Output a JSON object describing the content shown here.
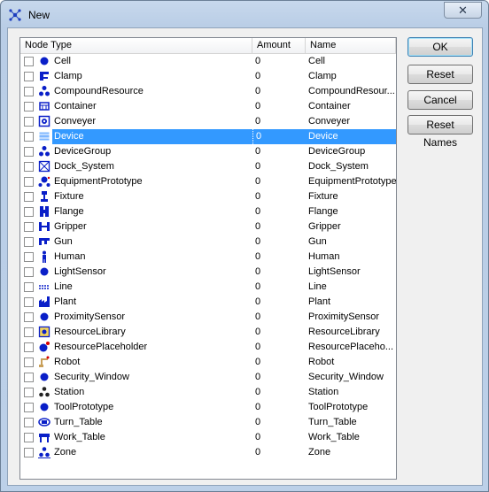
{
  "window": {
    "title": "New",
    "close_glyph": "✕"
  },
  "colors": {
    "selection": "#3399ff",
    "icon_blue": "#0000cc"
  },
  "list": {
    "columns": [
      "Node Type",
      "Amount",
      "Name"
    ],
    "rows": [
      {
        "type": "Cell",
        "amount": "0",
        "name": "Cell",
        "icon": "dot-icon"
      },
      {
        "type": "Clamp",
        "amount": "0",
        "name": "Clamp",
        "icon": "clamp-icon"
      },
      {
        "type": "CompoundResource",
        "amount": "0",
        "name": "CompoundResour...",
        "icon": "tri-dot-icon"
      },
      {
        "type": "Container",
        "amount": "0",
        "name": "Container",
        "icon": "container-icon"
      },
      {
        "type": "Conveyer",
        "amount": "0",
        "name": "Conveyer",
        "icon": "conveyer-icon"
      },
      {
        "type": "Device",
        "amount": "0",
        "name": "Device",
        "icon": "device-icon",
        "selected": true
      },
      {
        "type": "DeviceGroup",
        "amount": "0",
        "name": "DeviceGroup",
        "icon": "tri-dot-icon"
      },
      {
        "type": "Dock_System",
        "amount": "0",
        "name": "Dock_System",
        "icon": "dock-icon"
      },
      {
        "type": "EquipmentPrototype",
        "amount": "0",
        "name": "EquipmentPrototype",
        "icon": "equipment-icon"
      },
      {
        "type": "Fixture",
        "amount": "0",
        "name": "Fixture",
        "icon": "fixture-icon"
      },
      {
        "type": "Flange",
        "amount": "0",
        "name": "Flange",
        "icon": "flange-icon"
      },
      {
        "type": "Gripper",
        "amount": "0",
        "name": "Gripper",
        "icon": "gripper-icon"
      },
      {
        "type": "Gun",
        "amount": "0",
        "name": "Gun",
        "icon": "gun-icon"
      },
      {
        "type": "Human",
        "amount": "0",
        "name": "Human",
        "icon": "human-icon"
      },
      {
        "type": "LightSensor",
        "amount": "0",
        "name": "LightSensor",
        "icon": "dot-icon"
      },
      {
        "type": "Line",
        "amount": "0",
        "name": "Line",
        "icon": "line-icon"
      },
      {
        "type": "Plant",
        "amount": "0",
        "name": "Plant",
        "icon": "plant-icon"
      },
      {
        "type": "ProximitySensor",
        "amount": "0",
        "name": "ProximitySensor",
        "icon": "dot-icon"
      },
      {
        "type": "ResourceLibrary",
        "amount": "0",
        "name": "ResourceLibrary",
        "icon": "library-icon"
      },
      {
        "type": "ResourcePlaceholder",
        "amount": "0",
        "name": "ResourcePlaceho...",
        "icon": "placeholder-icon"
      },
      {
        "type": "Robot",
        "amount": "0",
        "name": "Robot",
        "icon": "robot-icon"
      },
      {
        "type": "Security_Window",
        "amount": "0",
        "name": "Security_Window",
        "icon": "dot-icon"
      },
      {
        "type": "Station",
        "amount": "0",
        "name": "Station",
        "icon": "station-icon"
      },
      {
        "type": "ToolPrototype",
        "amount": "0",
        "name": "ToolPrototype",
        "icon": "dot-icon"
      },
      {
        "type": "Turn_Table",
        "amount": "0",
        "name": "Turn_Table",
        "icon": "turntable-icon"
      },
      {
        "type": "Work_Table",
        "amount": "0",
        "name": "Work_Table",
        "icon": "worktable-icon"
      },
      {
        "type": "Zone",
        "amount": "0",
        "name": "Zone",
        "icon": "zone-icon"
      }
    ]
  },
  "buttons": {
    "ok": "OK",
    "reset": "Reset",
    "cancel": "Cancel",
    "reset_names": "Reset Names"
  }
}
